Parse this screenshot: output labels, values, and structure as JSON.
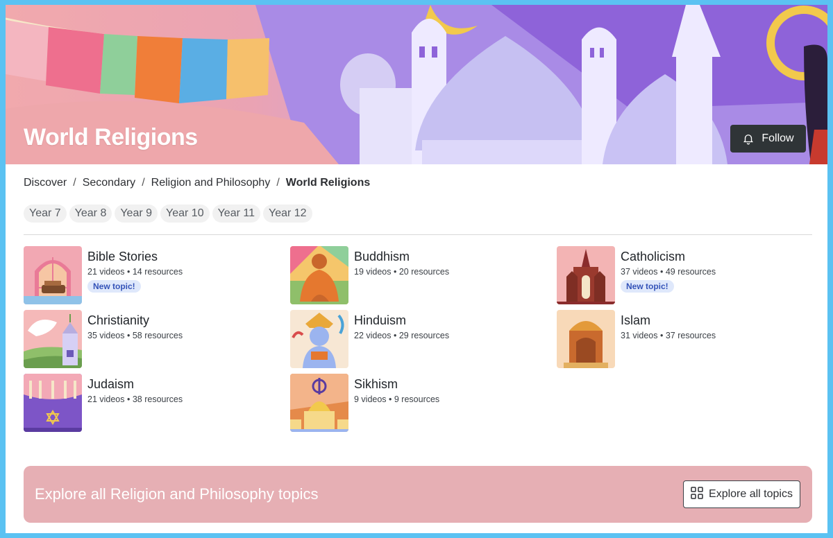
{
  "header": {
    "title": "World Religions",
    "follow_label": "Follow"
  },
  "breadcrumb": [
    "Discover",
    "Secondary",
    "Religion and Philosophy",
    "World Religions"
  ],
  "years": [
    "Year 7",
    "Year 8",
    "Year 9",
    "Year 10",
    "Year 11",
    "Year 12"
  ],
  "topics": [
    {
      "name": "Bible Stories",
      "meta": "21 videos • 14 resources",
      "badge": "New topic!"
    },
    {
      "name": "Buddhism",
      "meta": "19 videos • 20 resources",
      "badge": ""
    },
    {
      "name": "Catholicism",
      "meta": "37 videos • 49 resources",
      "badge": "New topic!"
    },
    {
      "name": "Christianity",
      "meta": "35 videos • 58 resources",
      "badge": ""
    },
    {
      "name": "Hinduism",
      "meta": "22 videos • 29 resources",
      "badge": ""
    },
    {
      "name": "Islam",
      "meta": "31 videos • 37 resources",
      "badge": ""
    },
    {
      "name": "Judaism",
      "meta": "21 videos • 38 resources",
      "badge": ""
    },
    {
      "name": "Sikhism",
      "meta": "9 videos • 9 resources",
      "badge": ""
    }
  ],
  "explore": {
    "text": "Explore all Religion and Philosophy topics",
    "button_label": "Explore all topics"
  },
  "colors": {
    "accent_dark": "#2f3437",
    "badge_bg": "#dfe8fb",
    "badge_text": "#3453b8",
    "explore_bg": "#e6afb4",
    "frame_border": "#5bc2f2"
  },
  "icons": {
    "follow": "bell-icon",
    "explore": "grid-icon"
  }
}
